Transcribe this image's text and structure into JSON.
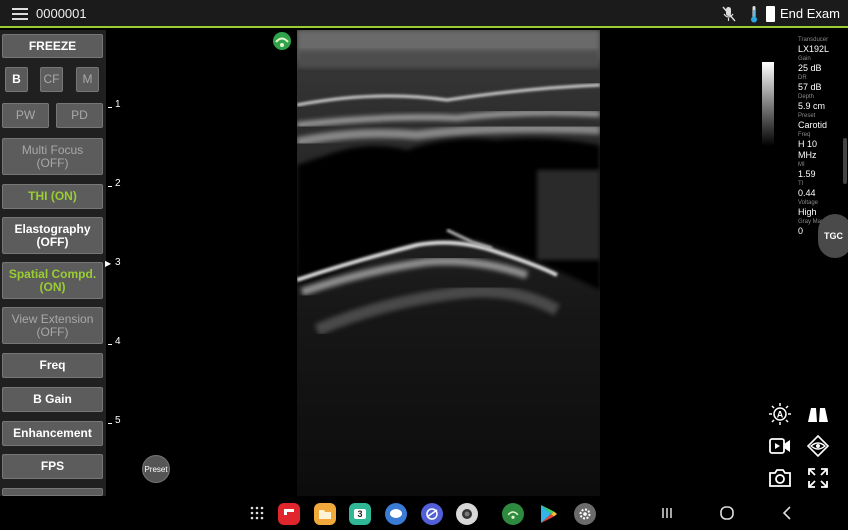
{
  "topbar": {
    "exam_id": "0000001",
    "end_exam": "End Exam"
  },
  "left_panel": {
    "freeze": "FREEZE",
    "mode_b": "B",
    "mode_cf": "CF",
    "mode_m": "M",
    "mode_pw": "PW",
    "mode_pd": "PD",
    "multi_focus": "Multi Focus",
    "multi_focus_state": "(OFF)",
    "thi": "THI (ON)",
    "elastography": "Elastography",
    "elastography_state": "(OFF)",
    "spatial_compd": "Spatial Compd.",
    "spatial_compd_state": "(ON)",
    "view_extension": "View Extension",
    "view_extension_state": "(OFF)",
    "freq": "Freq",
    "b_gain": "B Gain",
    "enhancement": "Enhancement",
    "fps": "FPS"
  },
  "depth_scale": [
    "1",
    "2",
    "3",
    "4",
    "5"
  ],
  "preset_button": "Preset",
  "info_panel": [
    {
      "key": "Transducer",
      "value": "LX192L"
    },
    {
      "key": "Gain",
      "value": "25 dB"
    },
    {
      "key": "DR",
      "value": "57 dB"
    },
    {
      "key": "Depth",
      "value": "5.9 cm"
    },
    {
      "key": "Preset",
      "value": "Carotid"
    },
    {
      "key": "Freq",
      "value": "H 10"
    },
    {
      "key": "",
      "value": "MHz"
    },
    {
      "key": "MI",
      "value": "1.59"
    },
    {
      "key": "TI",
      "value": "0.44"
    },
    {
      "key": "Voltage",
      "value": "High"
    },
    {
      "key": "Gray Map",
      "value": "0"
    }
  ],
  "tgc_button": "TGC",
  "colors": {
    "accent_green": "#9acd32",
    "button_gray": "#5c5c5c",
    "panel_bg": "#202020"
  },
  "dock_apps": [
    {
      "name": "app-drawer-icon"
    },
    {
      "name": "flipboard-icon",
      "color": "#e0262c"
    },
    {
      "name": "files-icon",
      "color": "#f2a93b"
    },
    {
      "name": "calendar-icon",
      "color": "#2fb796",
      "label": "3"
    },
    {
      "name": "messages-icon",
      "color": "#3a7bd5"
    },
    {
      "name": "internet-icon",
      "color": "#5160d8"
    },
    {
      "name": "camera-app-icon",
      "color": "#d8d8d8"
    },
    {
      "name": "ultrasound-app-icon",
      "color": "#2d8a3e"
    },
    {
      "name": "play-store-icon",
      "color": "#ffffff"
    },
    {
      "name": "settings-icon",
      "color": "#6b6b6b"
    }
  ]
}
